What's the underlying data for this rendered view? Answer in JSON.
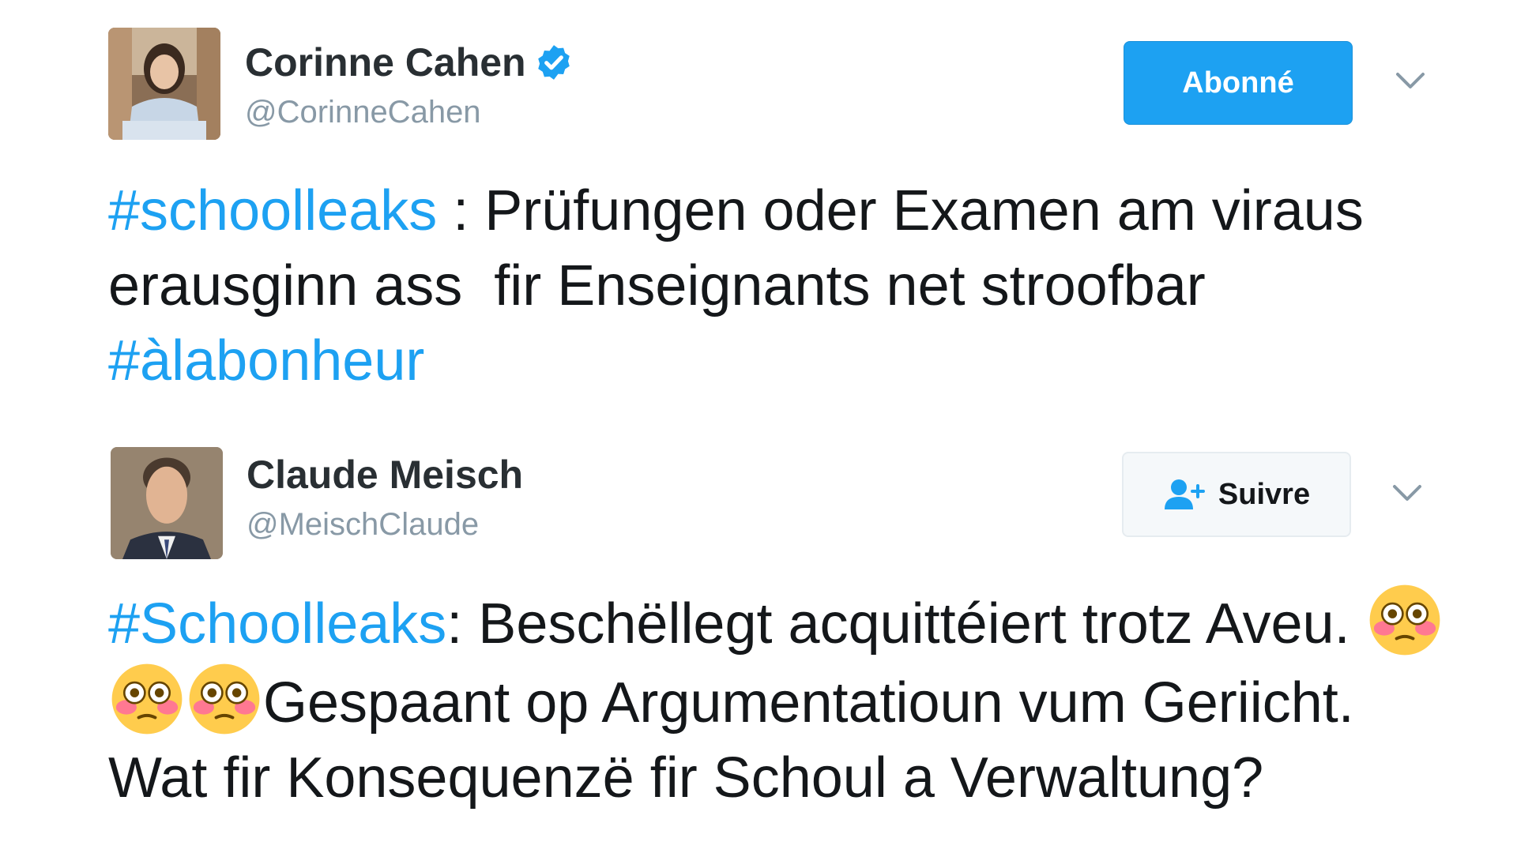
{
  "tweets": [
    {
      "author": {
        "display_name": "Corinne Cahen",
        "handle": "@CorinneCahen",
        "verified": true,
        "avatar_icon": "woman-portrait-avatar"
      },
      "follow_button": {
        "label": "Abonné",
        "state": "following"
      },
      "menu_icon": "chevron-down-icon",
      "text": {
        "hashtag1": "#schoolleaks",
        "part1": " : Prüfungen oder Examen am viraus erausginn ass  fir Enseignants net stroofbar ",
        "hashtag2": "#àlabonheur"
      }
    },
    {
      "author": {
        "display_name": "Claude Meisch",
        "handle": "@MeischClaude",
        "verified": false,
        "avatar_icon": "man-portrait-avatar"
      },
      "follow_button": {
        "label": "Suivre",
        "state": "not-following",
        "icon": "add-user-icon"
      },
      "menu_icon": "chevron-down-icon",
      "text": {
        "hashtag1": "#Schoolleaks",
        "part1": ": Beschëllegt acquittéiert trotz Aveu. ",
        "emoji": "flushed-face-emoji",
        "part2": "Gespaant op Argumentatioun vum Geriicht. Wat fir Konsequenzë fir Schoul a Verwaltung?"
      }
    }
  ],
  "colors": {
    "accent": "#1da1f2",
    "text": "#14171a",
    "muted": "#8899a6",
    "emoji_yellow": "#ffcc4d"
  }
}
